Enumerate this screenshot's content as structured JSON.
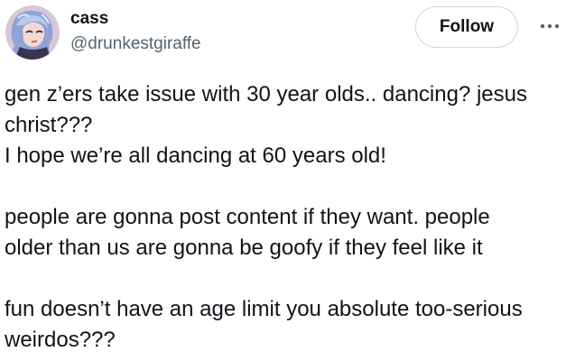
{
  "author": {
    "display_name": "cass",
    "handle": "@drunkestgiraffe"
  },
  "actions": {
    "follow_label": "Follow",
    "more_icon": "more-horizontal-icon"
  },
  "tweet": {
    "paragraphs": [
      [
        "gen z’ers take issue with 30 year olds.. dancing? jesus",
        "christ???",
        "I hope we’re all dancing at 60 years old!"
      ],
      [
        "people are gonna post content if they want. people",
        "older than us are gonna be goofy if they feel like it"
      ],
      [
        "fun doesn’t have an age limit you absolute too-serious",
        "weirdos???"
      ]
    ]
  },
  "colors": {
    "text": "#0f1419",
    "secondary": "#536471",
    "border": "#cfd9de"
  }
}
